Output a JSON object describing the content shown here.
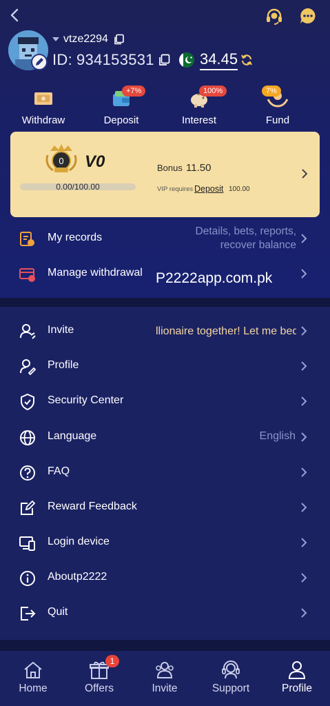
{
  "header": {
    "username": "vtze2294",
    "id_label": "ID:",
    "id_value": "934153531",
    "balance": "34.45"
  },
  "actions": [
    {
      "label": "Withdraw",
      "badge": ""
    },
    {
      "label": "Deposit",
      "badge": "+7%"
    },
    {
      "label": "Interest",
      "badge": "100%"
    },
    {
      "label": "Fund",
      "badge": "7%"
    }
  ],
  "vip": {
    "badge_number": "0",
    "level": "V0",
    "progress_text": "0.00/100.00",
    "progress_fraction": 0.0,
    "bonus_label": "Bonus",
    "bonus_value": "11.50",
    "requires_label": "VIP requires",
    "requires_link": "Deposit",
    "requires_amount": "100.00"
  },
  "records": {
    "my_records": "My records",
    "my_records_extra_line1": "Details, bets, reports,",
    "my_records_extra_line2": "recover balance",
    "manage_withdrawal": "Manage withdrawal",
    "watermark": "P2222app.com.pk"
  },
  "menu": {
    "invite": "Invite",
    "invite_extra": "llionaire together!  Let me bed",
    "profile": "Profile",
    "security": "Security Center",
    "language": "Language",
    "language_value": "English",
    "faq": "FAQ",
    "reward_feedback": "Reward Feedback",
    "login_device": "Login device",
    "about": "Aboutp2222",
    "quit": "Quit"
  },
  "tabs": [
    {
      "label": "Home"
    },
    {
      "label": "Offers",
      "badge": "1"
    },
    {
      "label": "Invite"
    },
    {
      "label": "Support"
    },
    {
      "label": "Profile",
      "active": true
    }
  ],
  "colors": {
    "background": "#1b2262",
    "vip_card": "#f6dfa4",
    "accent_gold": "#f3d6a2",
    "badge_red": "#e5483d",
    "badge_orange": "#f5a623"
  }
}
